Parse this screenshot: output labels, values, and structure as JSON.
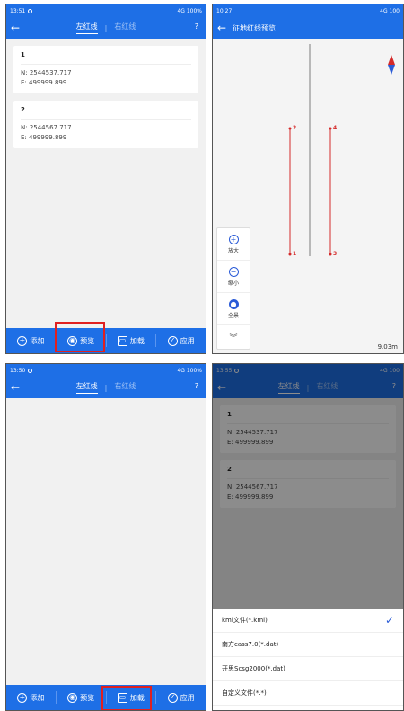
{
  "panel1": {
    "status_time": "13:51",
    "status_right": "4G 100%",
    "tab_active": "左红线",
    "tab_inactive": "右红线",
    "help": "?",
    "points": [
      {
        "num": "1",
        "n": "N: 2544537.717",
        "e": "E: 499999.899"
      },
      {
        "num": "2",
        "n": "N: 2544567.717",
        "e": "E: 499999.899"
      }
    ],
    "bottom": {
      "add": "添加",
      "preview": "预览",
      "load": "加载",
      "apply": "应用"
    }
  },
  "panel2": {
    "status_time": "10:27",
    "status_right": "4G 100",
    "title": "征地红线预览",
    "labels": {
      "p1": "1",
      "p2": "2",
      "p3": "3",
      "p4": "4"
    },
    "zoom": {
      "in": "放大",
      "out": "缩小",
      "full": "全景"
    },
    "scale": "9.03m"
  },
  "panel3": {
    "status_time": "13:50",
    "status_right": "4G 100%",
    "tab_active": "左红线",
    "tab_inactive": "右红线",
    "help": "?",
    "bottom": {
      "add": "添加",
      "preview": "预览",
      "load": "加载",
      "apply": "应用"
    }
  },
  "panel4": {
    "status_time": "13:55",
    "status_right": "4G 100",
    "tab_active": "左红线",
    "tab_inactive": "右红线",
    "help": "?",
    "points": [
      {
        "num": "1",
        "n": "N: 2544537.717",
        "e": "E: 499999.899"
      },
      {
        "num": "2",
        "n": "N: 2544567.717",
        "e": "E: 499999.899"
      }
    ],
    "options": [
      "kml文件(*.kml)",
      "南方cass7.0(*.dat)",
      "开思Scsg2000(*.dat)",
      "自定义文件(*.*)"
    ],
    "selected_option": 0
  },
  "colors": {
    "primary": "#1e6fe6",
    "highlight": "#e02020",
    "redline": "#d42a2a"
  }
}
